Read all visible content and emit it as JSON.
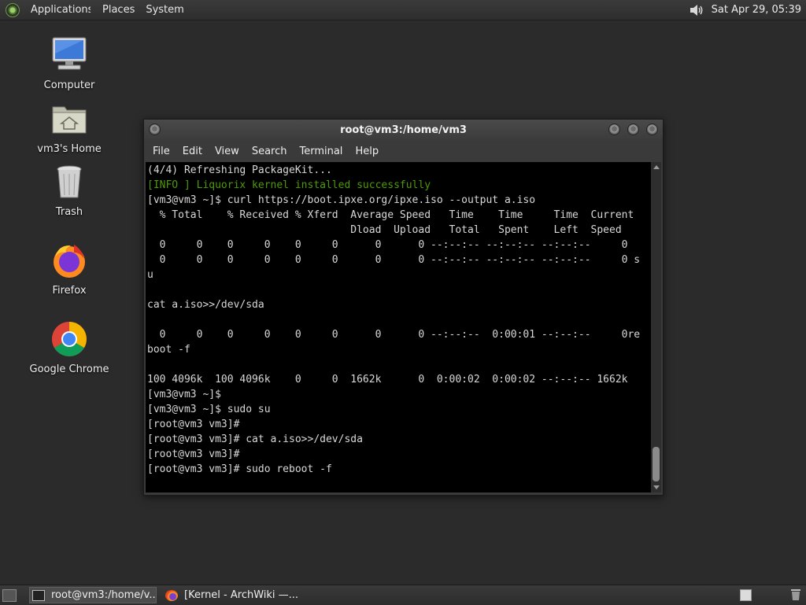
{
  "top_panel": {
    "menus": [
      "Applications",
      "Places",
      "System"
    ],
    "clock": "Sat Apr 29, 05:39"
  },
  "desktop": {
    "icons": [
      {
        "label": "Computer",
        "icon": "computer-icon"
      },
      {
        "label": "vm3's Home",
        "icon": "home-folder-icon"
      },
      {
        "label": "Trash",
        "icon": "trash-icon"
      },
      {
        "label": "Firefox",
        "icon": "firefox-icon"
      },
      {
        "label": "Google Chrome",
        "icon": "chrome-icon"
      }
    ]
  },
  "terminal": {
    "title": "root@vm3:/home/vm3",
    "menu": [
      "File",
      "Edit",
      "View",
      "Search",
      "Terminal",
      "Help"
    ],
    "lines": [
      "(4/4) Refreshing PackageKit...",
      "[INFO ] Liquorix kernel installed successfully",
      "[vm3@vm3 ~]$ curl https://boot.ipxe.org/ipxe.iso --output a.iso",
      "  % Total    % Received % Xferd  Average Speed   Time    Time     Time  Current",
      "                                 Dload  Upload   Total   Spent    Left  Speed",
      "  0     0    0     0    0     0      0      0 --:--:-- --:--:-- --:--:--     0",
      "  0     0    0     0    0     0      0      0 --:--:-- --:--:-- --:--:--     0 s",
      "u",
      "",
      "cat a.iso>>/dev/sda",
      "",
      "  0     0    0     0    0     0      0      0 --:--:--  0:00:01 --:--:--     0re",
      "boot -f",
      "",
      "100 4096k  100 4096k    0     0  1662k      0  0:00:02  0:00:02 --:--:-- 1662k",
      "[vm3@vm3 ~]$",
      "[vm3@vm3 ~]$ sudo su",
      "[root@vm3 vm3]#",
      "[root@vm3 vm3]# cat a.iso>>/dev/sda",
      "[root@vm3 vm3]#",
      "[root@vm3 vm3]# sudo reboot -f"
    ],
    "highlight_line_index": 1,
    "highlight_color": "#4e9a06"
  },
  "bottom_panel": {
    "tasks": [
      {
        "label": "root@vm3:/home/v...",
        "icon": "terminal-icon",
        "active": true
      },
      {
        "label": "[Kernel - ArchWiki —...",
        "icon": "firefox-icon",
        "active": false
      }
    ]
  }
}
